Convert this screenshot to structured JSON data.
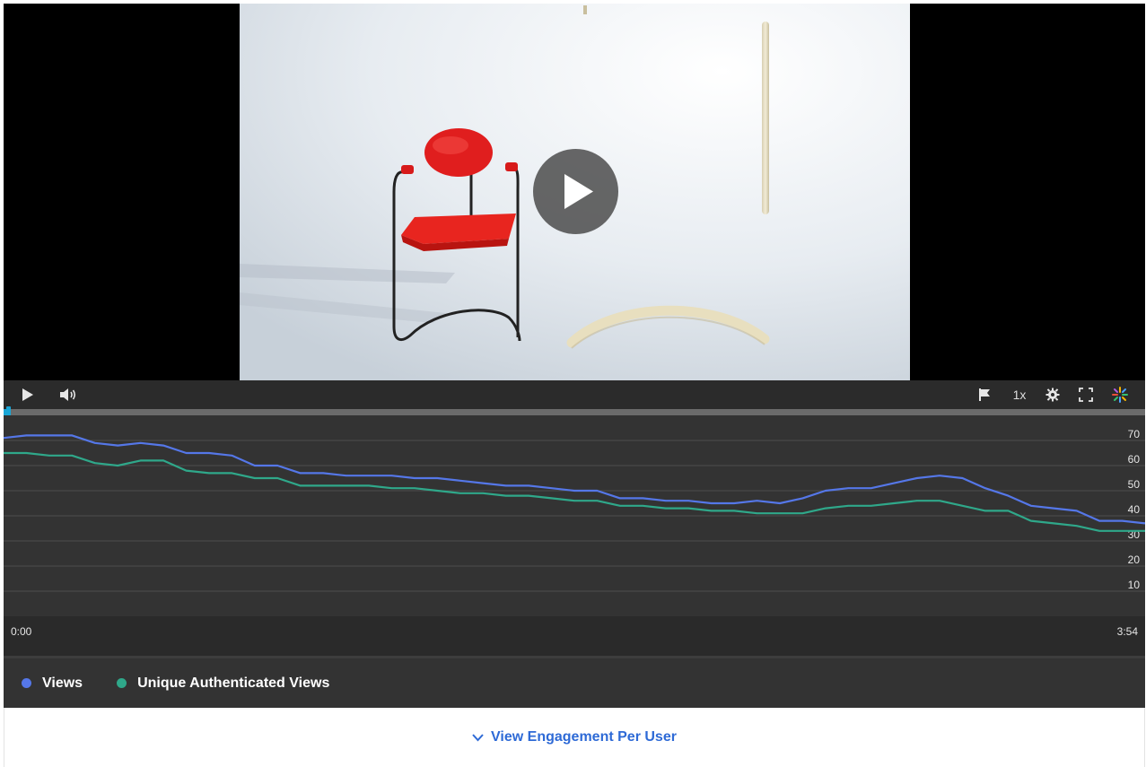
{
  "player": {
    "speed_label": "1x",
    "time_start": "0:00",
    "time_end": "3:54",
    "progress": 0.004
  },
  "chart_data": {
    "type": "line",
    "x_range": [
      "0:00",
      "3:54"
    ],
    "ylim": [
      0,
      80
    ],
    "yticks": [
      10,
      20,
      30,
      40,
      50,
      60,
      70
    ],
    "grid": true,
    "legend_position": "bottom-left",
    "x": [
      0,
      2,
      4,
      6,
      8,
      10,
      12,
      14,
      16,
      18,
      20,
      22,
      24,
      26,
      28,
      30,
      32,
      34,
      36,
      38,
      40,
      42,
      44,
      46,
      48,
      50,
      52,
      54,
      56,
      58,
      60,
      62,
      64,
      66,
      68,
      70,
      72,
      74,
      76,
      78,
      80,
      82,
      84,
      86,
      88,
      90,
      92,
      94,
      96,
      98,
      100
    ],
    "series": [
      {
        "name": "Views",
        "color": "#5577e8",
        "values": [
          71,
          72,
          72,
          72,
          69,
          68,
          69,
          68,
          65,
          65,
          64,
          60,
          60,
          57,
          57,
          56,
          56,
          56,
          55,
          55,
          54,
          53,
          52,
          52,
          51,
          50,
          50,
          47,
          47,
          46,
          46,
          45,
          45,
          46,
          45,
          47,
          50,
          51,
          51,
          53,
          55,
          56,
          55,
          51,
          48,
          44,
          43,
          42,
          38,
          38,
          37
        ]
      },
      {
        "name": "Unique Authenticated Views",
        "color": "#2fa88a",
        "values": [
          65,
          65,
          64,
          64,
          61,
          60,
          62,
          62,
          58,
          57,
          57,
          55,
          55,
          52,
          52,
          52,
          52,
          51,
          51,
          50,
          49,
          49,
          48,
          48,
          47,
          46,
          46,
          44,
          44,
          43,
          43,
          42,
          42,
          41,
          41,
          41,
          43,
          44,
          44,
          45,
          46,
          46,
          44,
          42,
          42,
          38,
          37,
          36,
          34,
          34,
          34
        ]
      }
    ]
  },
  "footer": {
    "engagement_link": "View Engagement Per User"
  }
}
